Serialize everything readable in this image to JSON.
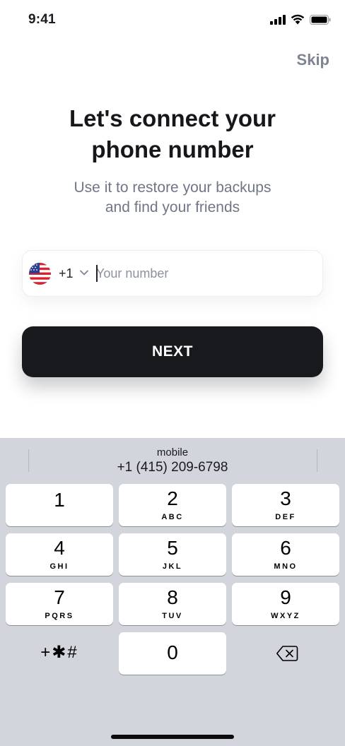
{
  "status_bar": {
    "time": "9:41"
  },
  "header": {
    "skip_label": "Skip"
  },
  "main": {
    "title_line1": "Let's connect your",
    "title_line2": "phone number",
    "subtitle_line1": "Use it to restore your backups",
    "subtitle_line2": "and find your friends"
  },
  "phone_field": {
    "flag_icon": "us-flag-icon",
    "country_code": "+1",
    "value": "",
    "placeholder": "Your number"
  },
  "next_button": {
    "label": "NEXT"
  },
  "keyboard": {
    "suggestion_label": "mobile",
    "suggestion_number": "+1 (415) 209-6798",
    "keys": [
      {
        "digit": "1",
        "letters": ""
      },
      {
        "digit": "2",
        "letters": "ABC"
      },
      {
        "digit": "3",
        "letters": "DEF"
      },
      {
        "digit": "4",
        "letters": "GHI"
      },
      {
        "digit": "5",
        "letters": "JKL"
      },
      {
        "digit": "6",
        "letters": "MNO"
      },
      {
        "digit": "7",
        "letters": "PQRS"
      },
      {
        "digit": "8",
        "letters": "TUV"
      },
      {
        "digit": "9",
        "letters": "WXYZ"
      },
      {
        "digit": "0",
        "letters": ""
      }
    ],
    "symbols_label": "+✱#",
    "delete_icon": "backspace-icon"
  },
  "colors": {
    "primary_button": "#17191d",
    "muted_text": "#7d8591",
    "keyboard_bg": "#d2d5db"
  }
}
